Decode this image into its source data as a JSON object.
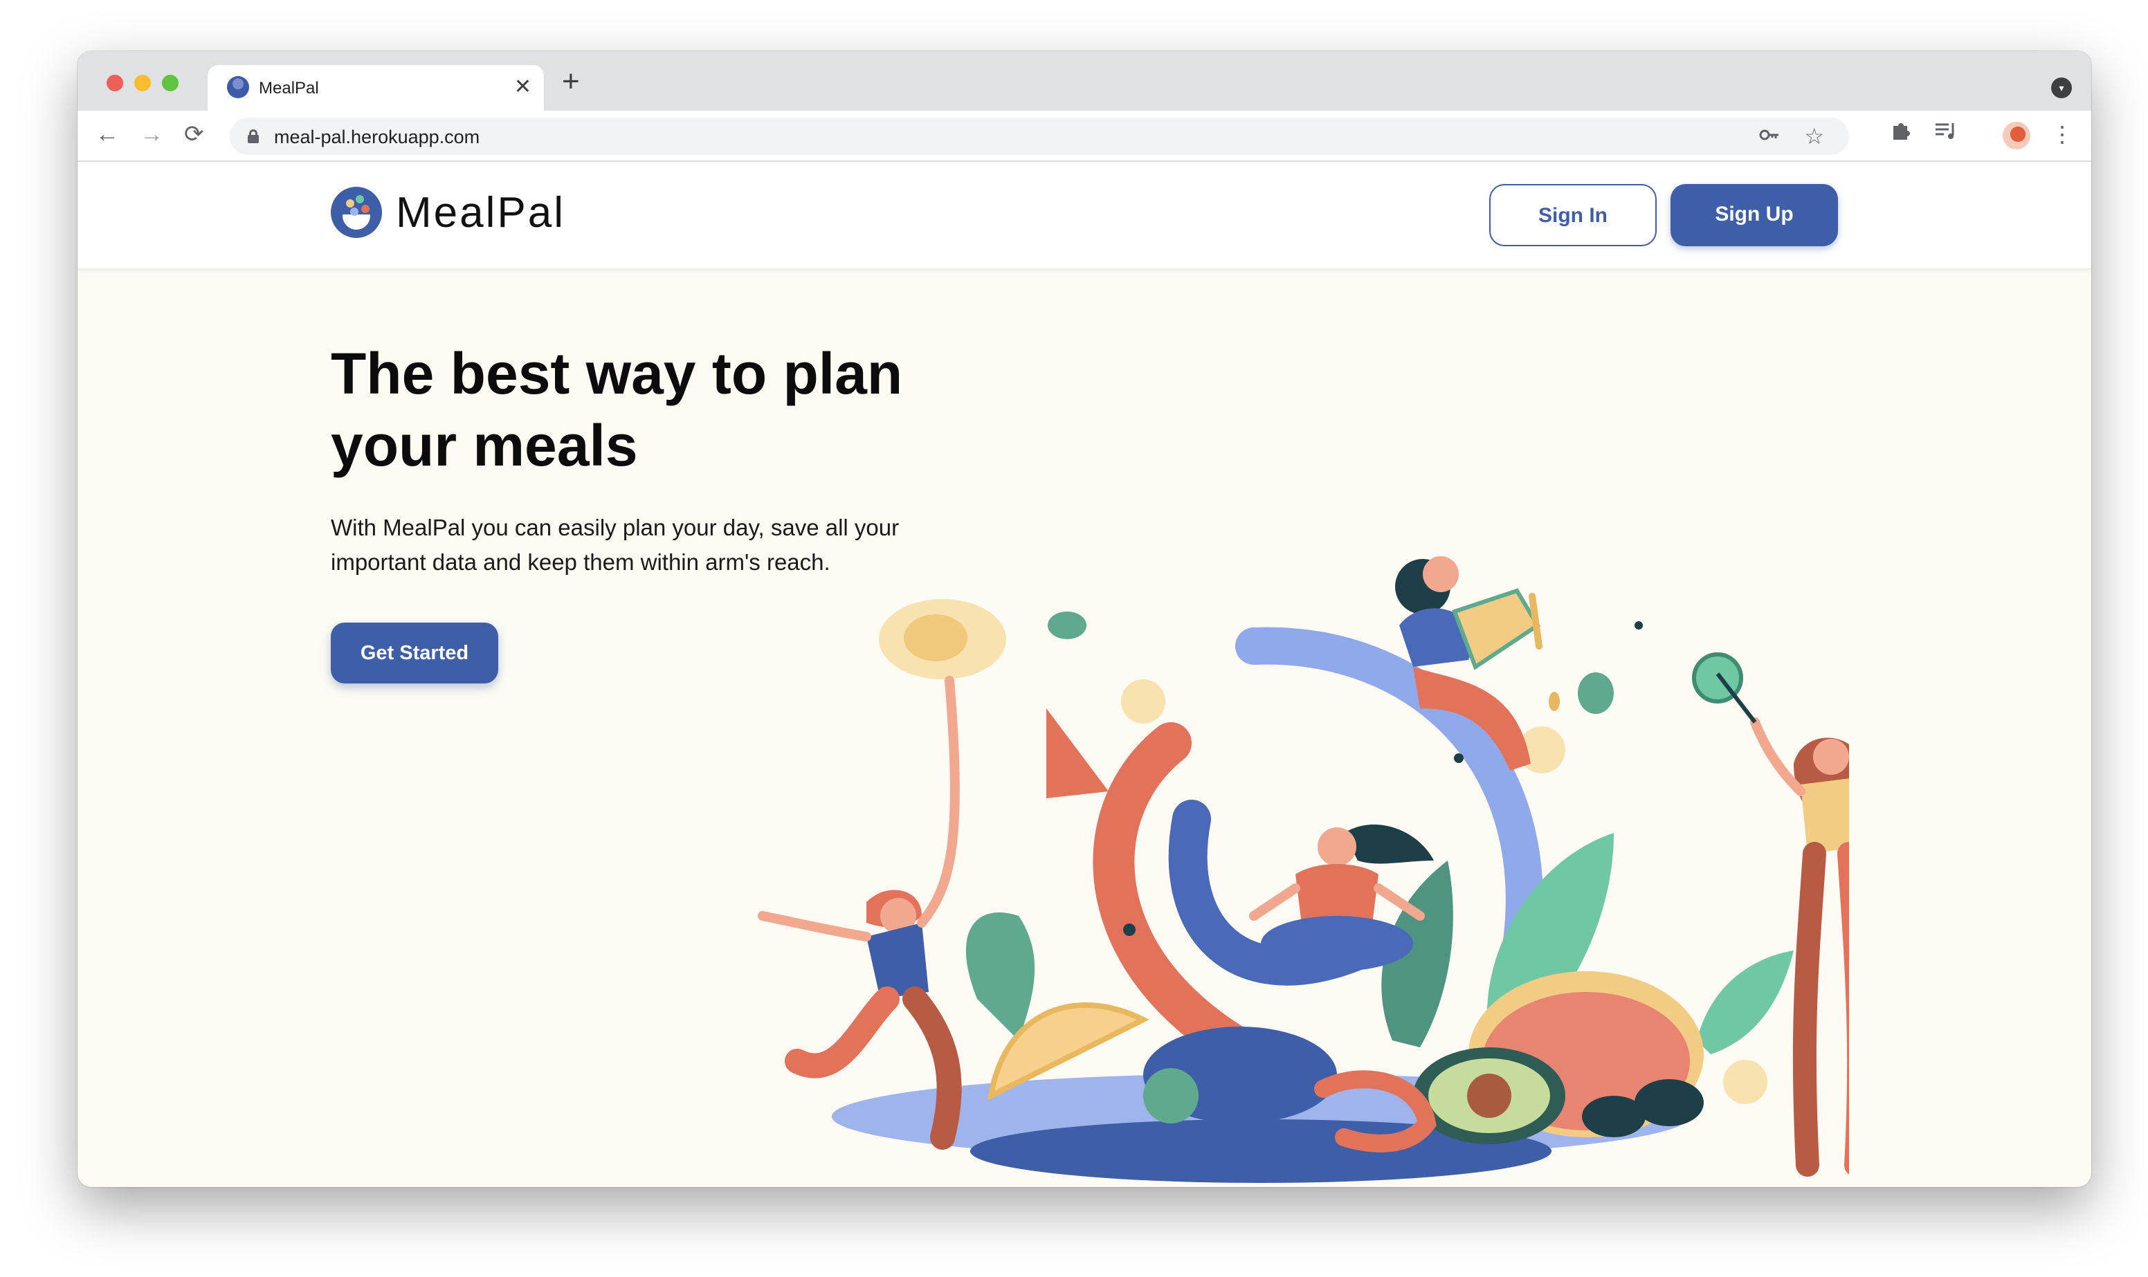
{
  "browser": {
    "tab_title": "MealPal",
    "tab_close": "✕",
    "new_tab": "+",
    "url": "meal-pal.herokuapp.com",
    "nav": {
      "back": "←",
      "forward": "→",
      "reload": "⟳"
    },
    "icons": [
      "key-icon",
      "star-icon",
      "puzzle-icon",
      "media-queue-icon",
      "profile-avatar",
      "kebab-menu-icon"
    ]
  },
  "header": {
    "logo_text": "MealPal",
    "sign_in": "Sign In",
    "sign_up": "Sign Up"
  },
  "hero": {
    "title": "The best way to plan your meals",
    "subtitle": "With MealPal you can easily plan your day, save all your important data and keep them within arm's reach.",
    "cta": "Get Started"
  },
  "colors": {
    "brand": "#3e5ea8",
    "background": "#fdfbf4",
    "accent_orange": "#e2735a",
    "accent_green": "#5fa98e",
    "accent_yellow": "#f2cc84"
  }
}
